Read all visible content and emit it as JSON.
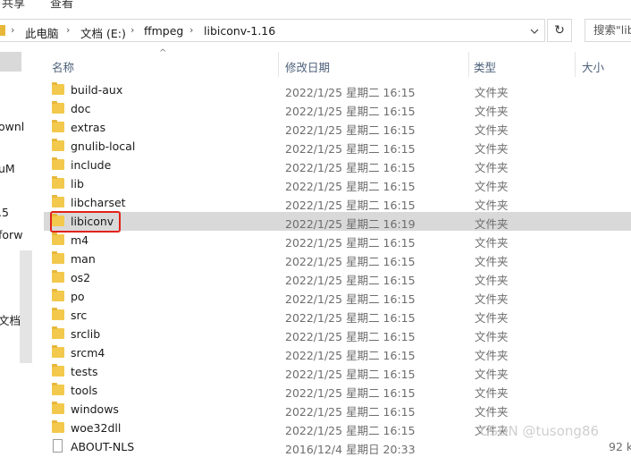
{
  "ribbon": {
    "tab_share": "共享",
    "tab_view": "查看"
  },
  "address": {
    "crumbs": [
      "此电脑",
      "文档 (E:)",
      "ffmpeg",
      "libiconv-1.16"
    ],
    "search_placeholder": "搜索\"lib"
  },
  "navpane": {
    "fragments": [
      "ownl",
      "uM",
      ".5",
      "forw",
      "文档"
    ]
  },
  "columns": {
    "name": "名称",
    "date": "修改日期",
    "type": "类型",
    "size": "大小"
  },
  "rows": [
    {
      "name": "build-aux",
      "date": "2022/1/25 星期二 16:15",
      "type": "文件夹",
      "size": "",
      "kind": "folder"
    },
    {
      "name": "doc",
      "date": "2022/1/25 星期二 16:15",
      "type": "文件夹",
      "size": "",
      "kind": "folder"
    },
    {
      "name": "extras",
      "date": "2022/1/25 星期二 16:15",
      "type": "文件夹",
      "size": "",
      "kind": "folder"
    },
    {
      "name": "gnulib-local",
      "date": "2022/1/25 星期二 16:15",
      "type": "文件夹",
      "size": "",
      "kind": "folder"
    },
    {
      "name": "include",
      "date": "2022/1/25 星期二 16:15",
      "type": "文件夹",
      "size": "",
      "kind": "folder"
    },
    {
      "name": "lib",
      "date": "2022/1/25 星期二 16:15",
      "type": "文件夹",
      "size": "",
      "kind": "folder"
    },
    {
      "name": "libcharset",
      "date": "2022/1/25 星期二 16:15",
      "type": "文件夹",
      "size": "",
      "kind": "folder"
    },
    {
      "name": "libiconv",
      "date": "2022/1/25 星期二 16:19",
      "type": "文件夹",
      "size": "",
      "kind": "folder",
      "selected": true
    },
    {
      "name": "m4",
      "date": "2022/1/25 星期二 16:15",
      "type": "文件夹",
      "size": "",
      "kind": "folder"
    },
    {
      "name": "man",
      "date": "2022/1/25 星期二 16:15",
      "type": "文件夹",
      "size": "",
      "kind": "folder"
    },
    {
      "name": "os2",
      "date": "2022/1/25 星期二 16:15",
      "type": "文件夹",
      "size": "",
      "kind": "folder"
    },
    {
      "name": "po",
      "date": "2022/1/25 星期二 16:15",
      "type": "文件夹",
      "size": "",
      "kind": "folder"
    },
    {
      "name": "src",
      "date": "2022/1/25 星期二 16:15",
      "type": "文件夹",
      "size": "",
      "kind": "folder"
    },
    {
      "name": "srclib",
      "date": "2022/1/25 星期二 16:15",
      "type": "文件夹",
      "size": "",
      "kind": "folder"
    },
    {
      "name": "srcm4",
      "date": "2022/1/25 星期二 16:15",
      "type": "文件夹",
      "size": "",
      "kind": "folder"
    },
    {
      "name": "tests",
      "date": "2022/1/25 星期二 16:15",
      "type": "文件夹",
      "size": "",
      "kind": "folder"
    },
    {
      "name": "tools",
      "date": "2022/1/25 星期二 16:15",
      "type": "文件夹",
      "size": "",
      "kind": "folder"
    },
    {
      "name": "windows",
      "date": "2022/1/25 星期二 16:15",
      "type": "文件夹",
      "size": "",
      "kind": "folder"
    },
    {
      "name": "woe32dll",
      "date": "2022/1/25 星期二 16:15",
      "type": "文件夹",
      "size": "",
      "kind": "folder"
    },
    {
      "name": "ABOUT-NLS",
      "date": "2016/12/4 星期日 20:33",
      "type": "",
      "size": "92 k",
      "kind": "file"
    }
  ],
  "watermark": "CSDN @tusong86",
  "colors": {
    "highlight": "#e2231a",
    "folder": "#f2c94c",
    "selected_row": "#d9d9d9"
  }
}
